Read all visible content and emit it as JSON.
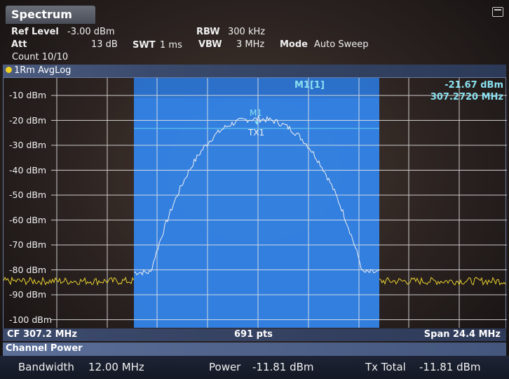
{
  "window": {
    "title": "Spectrum",
    "icon": "window-icon"
  },
  "settings": {
    "ref_level_label": "Ref Level",
    "ref_level_value": "-3.00 dBm",
    "att_label": "Att",
    "att_value": "13 dB",
    "swt_label": "SWT",
    "swt_value": "1 ms",
    "rbw_label": "RBW",
    "rbw_value": "300 kHz",
    "vbw_label": "VBW",
    "vbw_value": "3 MHz",
    "mode_label": "Mode",
    "mode_value": "Auto Sweep",
    "count": "Count 10/10"
  },
  "trace": {
    "label": "1Rm AvgLog",
    "color": "#f0d020"
  },
  "diagram": {
    "y_ticks": [
      "-10 dBm",
      "-20 dBm",
      "-30 dBm",
      "-40 dBm",
      "-50 dBm",
      "-60 dBm",
      "-70 dBm",
      "-80 dBm",
      "-90 dBm",
      "-100 dBm"
    ],
    "marker_name": "M1[1]",
    "marker_level": "-21.67 dBm",
    "marker_freq": "307.2720 MHz",
    "marker_tag": "M1",
    "channel_tag": "TX1",
    "channel_color": "#2a7ae0"
  },
  "axis": {
    "cf": "CF 307.2 MHz",
    "points": "691 pts",
    "span": "Span 24.4 MHz"
  },
  "channel_power": {
    "title": "Channel Power",
    "bandwidth_label": "Bandwidth",
    "bandwidth_value": "12.00 MHz",
    "power_label": "Power",
    "power_value": "-11.81 dBm",
    "tx_total_label": "Tx Total",
    "tx_total_value": "-11.81 dBm"
  }
}
